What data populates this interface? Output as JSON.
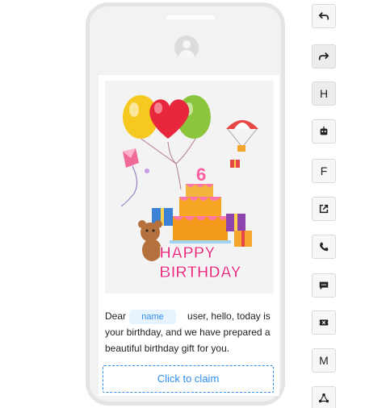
{
  "message": {
    "prefix": "Dear",
    "name_chip": "name",
    "body": "user, hello, today is your birthday, and we have prepared a beautiful birthday gift for you."
  },
  "picture": {
    "banner_line1": "HAPPY",
    "banner_line2": "BIRTHDAY",
    "cake_number": "6"
  },
  "claim_button": {
    "label": "Click to claim"
  },
  "toolbar": {
    "items": [
      {
        "icon": "undo-icon"
      },
      {
        "icon": "redo-icon"
      },
      {
        "icon": "heading-icon",
        "label": "H"
      },
      {
        "icon": "robot-icon"
      },
      {
        "icon": "font-icon",
        "label": "F"
      },
      {
        "icon": "open-external-icon"
      },
      {
        "icon": "phone-icon"
      },
      {
        "icon": "message-icon"
      },
      {
        "icon": "ticket-icon"
      },
      {
        "icon": "markdown-icon",
        "label": "M"
      },
      {
        "icon": "share-icon"
      }
    ]
  },
  "colors": {
    "accent": "#2d8cf0",
    "chip_bg": "#e8f4fd",
    "phone_frame": "#e4e4e4"
  }
}
